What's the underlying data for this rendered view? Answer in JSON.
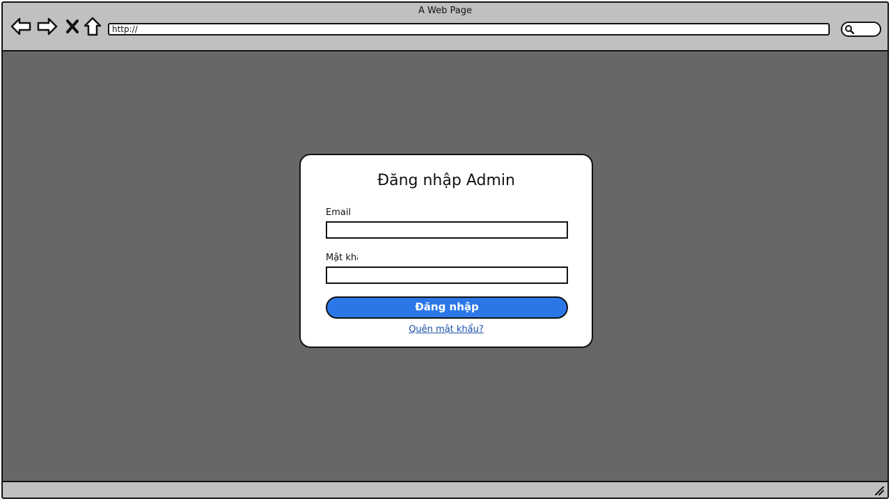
{
  "browser": {
    "title": "A Web Page",
    "address": "http://"
  },
  "login": {
    "title": "Đăng nhập Admin",
    "email_label": "Email",
    "email_value": "",
    "password_label": "Mật khẩu",
    "password_value": "",
    "submit_label": "Đăng nhập",
    "forgot_label": "Quên mật khẩu?",
    "submit_color": "#2b77e8",
    "link_color": "#1a4fa6"
  },
  "colors": {
    "chrome": "#c0c0c0",
    "viewport": "#676767"
  },
  "icons": [
    "back-arrow-icon",
    "forward-arrow-icon",
    "close-x-icon",
    "home-icon",
    "search-icon",
    "resize-grip-icon"
  ]
}
